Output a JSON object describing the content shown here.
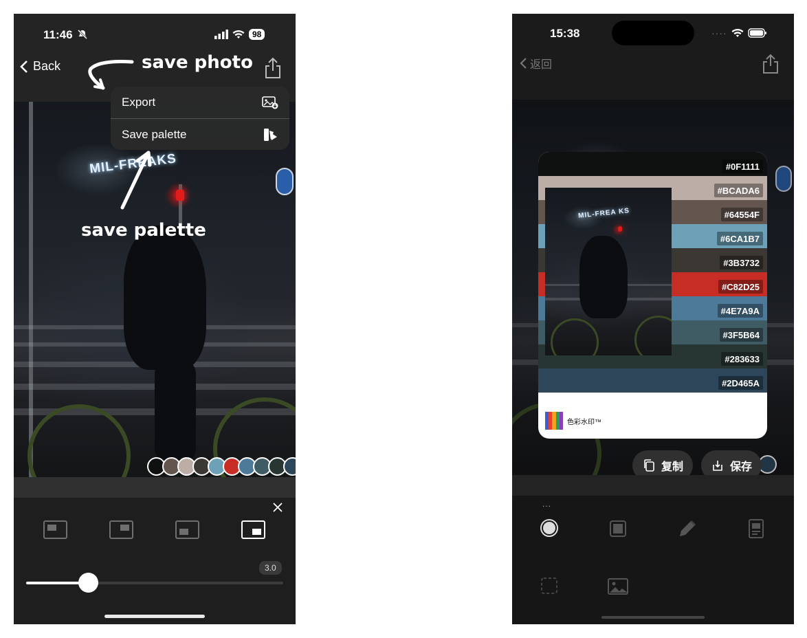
{
  "left": {
    "status": {
      "time": "11:46",
      "battery": "98"
    },
    "nav": {
      "back_label": "Back"
    },
    "photo_sign": "MIL-FREAKS",
    "menu": {
      "items": [
        {
          "label": "Export",
          "icon": "image-export-icon"
        },
        {
          "label": "Save palette",
          "icon": "palette-icon"
        }
      ]
    },
    "annotations": {
      "save_photo": "save photo",
      "save_palette": "save palette"
    },
    "palette_dots": [
      "#0F1111",
      "#64554F",
      "#BCADA6",
      "#3B3732",
      "#6CA1B7",
      "#C82D25",
      "#4E7A9A",
      "#3F5B64",
      "#283633",
      "#2D465A"
    ],
    "slider": {
      "value_label": "3.0",
      "value": 3.0
    }
  },
  "right": {
    "status": {
      "time": "15:38"
    },
    "nav": {
      "back_label": "返回"
    },
    "card": {
      "bands": [
        {
          "hex": "#0F1111",
          "color": "#0F1111"
        },
        {
          "hex": "#BCADA6",
          "color": "#BCADA6"
        },
        {
          "hex": "#64554F",
          "color": "#64554F"
        },
        {
          "hex": "#6CA1B7",
          "color": "#6CA1B7"
        },
        {
          "hex": "#3B3732",
          "color": "#3B3732"
        },
        {
          "hex": "#C82D25",
          "color": "#C82D25"
        },
        {
          "hex": "#4E7A9A",
          "color": "#4E7A9A"
        },
        {
          "hex": "#3F5B64",
          "color": "#3F5B64"
        },
        {
          "hex": "#283633",
          "color": "#283633"
        },
        {
          "hex": "#2D465A",
          "color": "#2D465A"
        }
      ],
      "thumb_sign": "MIL-FREA KS",
      "brand_name": "色彩水印™"
    },
    "actions": {
      "copy_label": "复制",
      "save_label": "保存"
    },
    "toolbar_more": "..."
  }
}
